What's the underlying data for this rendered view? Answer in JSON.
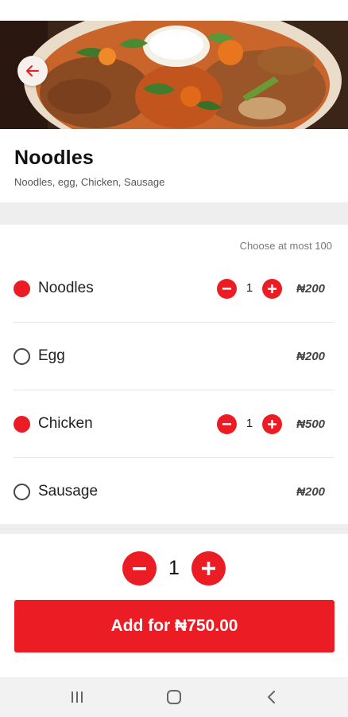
{
  "header": {
    "image_alt": "Plate of jollof rice, grilled chicken, salad and peppers"
  },
  "item": {
    "title": "Noodles",
    "description": "Noodles, egg, Chicken, Sausage"
  },
  "options": {
    "limit_note": "Choose at most 100",
    "items": [
      {
        "label": "Noodles",
        "selected": true,
        "quantity": "1",
        "price": "₦200"
      },
      {
        "label": "Egg",
        "selected": false,
        "price": "₦200"
      },
      {
        "label": "Chicken",
        "selected": true,
        "quantity": "1",
        "price": "₦500"
      },
      {
        "label": "Sausage",
        "selected": false,
        "price": "₦200"
      }
    ]
  },
  "order": {
    "quantity": "1",
    "add_label": "Add for ₦750.00"
  },
  "colors": {
    "accent": "#ec1c24",
    "divider": "#eeeeee"
  },
  "icons": [
    "arrow-left-icon",
    "minus-icon",
    "plus-icon",
    "recent-apps-icon",
    "home-icon",
    "back-nav-icon"
  ]
}
